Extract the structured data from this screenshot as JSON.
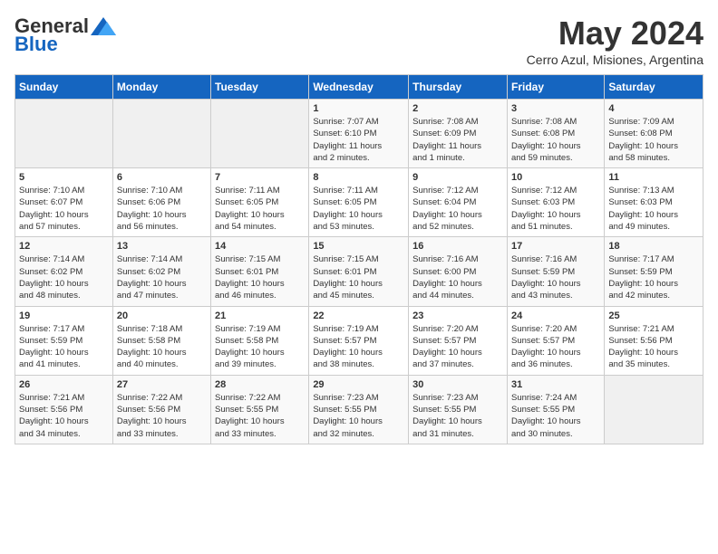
{
  "logo": {
    "general": "General",
    "blue": "Blue"
  },
  "title": "May 2024",
  "subtitle": "Cerro Azul, Misiones, Argentina",
  "days_header": [
    "Sunday",
    "Monday",
    "Tuesday",
    "Wednesday",
    "Thursday",
    "Friday",
    "Saturday"
  ],
  "weeks": [
    [
      {
        "day": "",
        "info": ""
      },
      {
        "day": "",
        "info": ""
      },
      {
        "day": "",
        "info": ""
      },
      {
        "day": "1",
        "info": "Sunrise: 7:07 AM\nSunset: 6:10 PM\nDaylight: 11 hours\nand 2 minutes."
      },
      {
        "day": "2",
        "info": "Sunrise: 7:08 AM\nSunset: 6:09 PM\nDaylight: 11 hours\nand 1 minute."
      },
      {
        "day": "3",
        "info": "Sunrise: 7:08 AM\nSunset: 6:08 PM\nDaylight: 10 hours\nand 59 minutes."
      },
      {
        "day": "4",
        "info": "Sunrise: 7:09 AM\nSunset: 6:08 PM\nDaylight: 10 hours\nand 58 minutes."
      }
    ],
    [
      {
        "day": "5",
        "info": "Sunrise: 7:10 AM\nSunset: 6:07 PM\nDaylight: 10 hours\nand 57 minutes."
      },
      {
        "day": "6",
        "info": "Sunrise: 7:10 AM\nSunset: 6:06 PM\nDaylight: 10 hours\nand 56 minutes."
      },
      {
        "day": "7",
        "info": "Sunrise: 7:11 AM\nSunset: 6:05 PM\nDaylight: 10 hours\nand 54 minutes."
      },
      {
        "day": "8",
        "info": "Sunrise: 7:11 AM\nSunset: 6:05 PM\nDaylight: 10 hours\nand 53 minutes."
      },
      {
        "day": "9",
        "info": "Sunrise: 7:12 AM\nSunset: 6:04 PM\nDaylight: 10 hours\nand 52 minutes."
      },
      {
        "day": "10",
        "info": "Sunrise: 7:12 AM\nSunset: 6:03 PM\nDaylight: 10 hours\nand 51 minutes."
      },
      {
        "day": "11",
        "info": "Sunrise: 7:13 AM\nSunset: 6:03 PM\nDaylight: 10 hours\nand 49 minutes."
      }
    ],
    [
      {
        "day": "12",
        "info": "Sunrise: 7:14 AM\nSunset: 6:02 PM\nDaylight: 10 hours\nand 48 minutes."
      },
      {
        "day": "13",
        "info": "Sunrise: 7:14 AM\nSunset: 6:02 PM\nDaylight: 10 hours\nand 47 minutes."
      },
      {
        "day": "14",
        "info": "Sunrise: 7:15 AM\nSunset: 6:01 PM\nDaylight: 10 hours\nand 46 minutes."
      },
      {
        "day": "15",
        "info": "Sunrise: 7:15 AM\nSunset: 6:01 PM\nDaylight: 10 hours\nand 45 minutes."
      },
      {
        "day": "16",
        "info": "Sunrise: 7:16 AM\nSunset: 6:00 PM\nDaylight: 10 hours\nand 44 minutes."
      },
      {
        "day": "17",
        "info": "Sunrise: 7:16 AM\nSunset: 5:59 PM\nDaylight: 10 hours\nand 43 minutes."
      },
      {
        "day": "18",
        "info": "Sunrise: 7:17 AM\nSunset: 5:59 PM\nDaylight: 10 hours\nand 42 minutes."
      }
    ],
    [
      {
        "day": "19",
        "info": "Sunrise: 7:17 AM\nSunset: 5:59 PM\nDaylight: 10 hours\nand 41 minutes."
      },
      {
        "day": "20",
        "info": "Sunrise: 7:18 AM\nSunset: 5:58 PM\nDaylight: 10 hours\nand 40 minutes."
      },
      {
        "day": "21",
        "info": "Sunrise: 7:19 AM\nSunset: 5:58 PM\nDaylight: 10 hours\nand 39 minutes."
      },
      {
        "day": "22",
        "info": "Sunrise: 7:19 AM\nSunset: 5:57 PM\nDaylight: 10 hours\nand 38 minutes."
      },
      {
        "day": "23",
        "info": "Sunrise: 7:20 AM\nSunset: 5:57 PM\nDaylight: 10 hours\nand 37 minutes."
      },
      {
        "day": "24",
        "info": "Sunrise: 7:20 AM\nSunset: 5:57 PM\nDaylight: 10 hours\nand 36 minutes."
      },
      {
        "day": "25",
        "info": "Sunrise: 7:21 AM\nSunset: 5:56 PM\nDaylight: 10 hours\nand 35 minutes."
      }
    ],
    [
      {
        "day": "26",
        "info": "Sunrise: 7:21 AM\nSunset: 5:56 PM\nDaylight: 10 hours\nand 34 minutes."
      },
      {
        "day": "27",
        "info": "Sunrise: 7:22 AM\nSunset: 5:56 PM\nDaylight: 10 hours\nand 33 minutes."
      },
      {
        "day": "28",
        "info": "Sunrise: 7:22 AM\nSunset: 5:55 PM\nDaylight: 10 hours\nand 33 minutes."
      },
      {
        "day": "29",
        "info": "Sunrise: 7:23 AM\nSunset: 5:55 PM\nDaylight: 10 hours\nand 32 minutes."
      },
      {
        "day": "30",
        "info": "Sunrise: 7:23 AM\nSunset: 5:55 PM\nDaylight: 10 hours\nand 31 minutes."
      },
      {
        "day": "31",
        "info": "Sunrise: 7:24 AM\nSunset: 5:55 PM\nDaylight: 10 hours\nand 30 minutes."
      },
      {
        "day": "",
        "info": ""
      }
    ]
  ]
}
